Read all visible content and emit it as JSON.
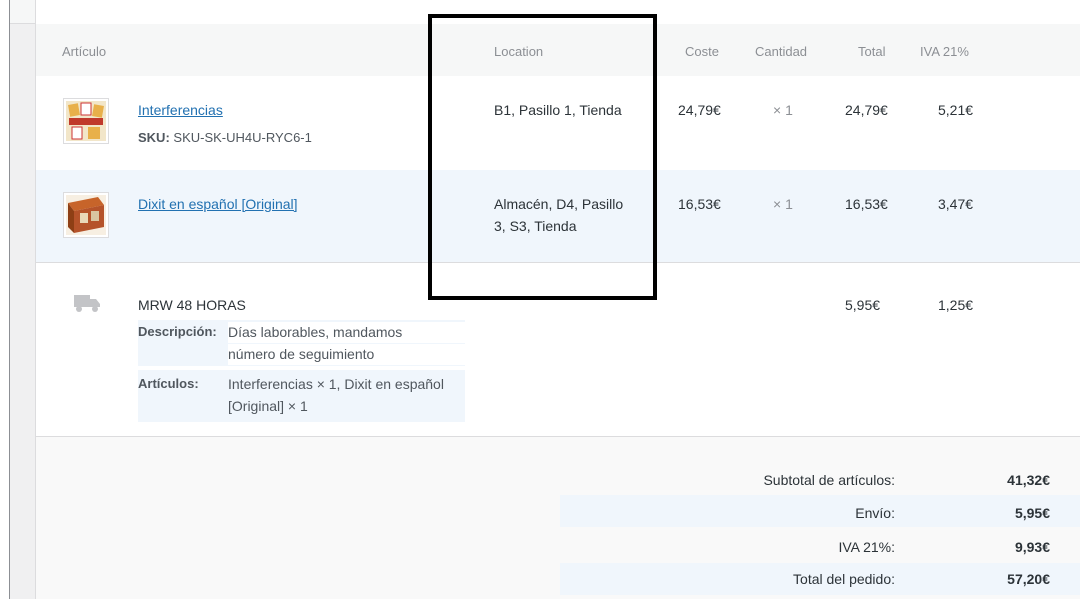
{
  "headers": {
    "item": "Artículo",
    "location": "Location",
    "cost": "Coste",
    "qty": "Cantidad",
    "total": "Total",
    "tax": "IVA 21%"
  },
  "items": [
    {
      "name": "Interferencias",
      "sku_label": "SKU:",
      "sku": "SKU-SK-UH4U-RYC6-1",
      "location": "B1, Pasillo 1, Tienda",
      "cost": "24,79€",
      "qty": "× 1",
      "total": "24,79€",
      "tax": "5,21€"
    },
    {
      "name": "Dixit en español [Original]",
      "location_line1": "Almacén, D4, Pasillo",
      "location_line2": "3, S3, Tienda",
      "cost": "16,53€",
      "qty": "× 1",
      "total": "16,53€",
      "tax": "3,47€"
    }
  ],
  "shipping": {
    "method": "MRW 48 HORAS",
    "desc_label": "Descripción:",
    "desc_line1": "Días laborables, mandamos",
    "desc_line2": "número de seguimiento",
    "items_label": "Artículos:",
    "items_line1": "Interferencias × 1, Dixit en español",
    "items_line2": "[Original] × 1",
    "total": "5,95€",
    "tax": "1,25€"
  },
  "totals": [
    {
      "label": "Subtotal de artículos:",
      "value": "41,32€"
    },
    {
      "label": "Envío:",
      "value": "5,95€"
    },
    {
      "label": "IVA 21%:",
      "value": "9,93€"
    },
    {
      "label": "Total del pedido:",
      "value": "57,20€"
    }
  ],
  "colors": {
    "link": "#2271b1",
    "highlight_row": "#f0f6fc",
    "annotation_box": "#000000"
  }
}
